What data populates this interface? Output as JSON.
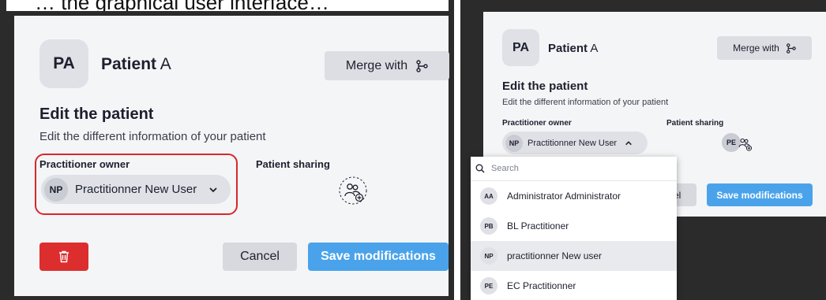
{
  "left": {
    "caption_text": "… the graphical user interface…",
    "patient": {
      "initials": "PA",
      "name_bold": "Patient",
      "name_rest": " A"
    },
    "merge_label": "Merge with",
    "edit_title": "Edit the patient",
    "edit_subtitle": "Edit the different information of your patient",
    "owner_label": "Practitioner owner",
    "sharing_label": "Patient sharing",
    "owner": {
      "initials": "NP",
      "name": "Practitionner New User"
    },
    "cancel_label": "Cancel",
    "save_label": "Save modifications"
  },
  "right": {
    "patient": {
      "initials": "PA",
      "name_bold": "Patient",
      "name_rest": " A"
    },
    "merge_label": "Merge with",
    "edit_title": "Edit the patient",
    "edit_subtitle": "Edit the different information of your patient",
    "owner_label": "Practitioner owner",
    "sharing_label": "Patient sharing",
    "owner": {
      "initials": "NP",
      "name": "Practitionner New User"
    },
    "sharing_initials": "PE",
    "cancel_label": "el",
    "save_label": "Save modifications",
    "dropdown": {
      "search_placeholder": "Search",
      "options": [
        {
          "initials": "AA",
          "name": "Administrator Administrator"
        },
        {
          "initials": "PB",
          "name": "BL Practitioner"
        },
        {
          "initials": "NP",
          "name": "practitionner New user"
        },
        {
          "initials": "PE",
          "name": "EC Practitionner"
        }
      ]
    }
  },
  "colors": {
    "save": "#4aa3ea",
    "delete": "#dc2e2e",
    "highlight": "#d9262c",
    "card": "#f4f5f7",
    "background": "#2b2b2b"
  },
  "icons": [
    "merge-icon",
    "chevron-down-icon",
    "chevron-up-icon",
    "add-users-icon",
    "trash-icon",
    "search-icon"
  ]
}
